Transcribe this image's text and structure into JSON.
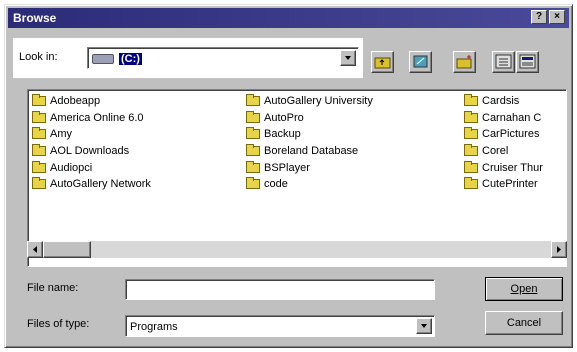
{
  "window": {
    "title": "Browse",
    "help_btn": "?",
    "close_btn": "×"
  },
  "lookin": {
    "label": "Look in:",
    "value": "(C:)"
  },
  "files": {
    "col1": [
      "Adobeapp",
      "America Online 6.0",
      "Amy",
      "AOL Downloads",
      "Audiopci",
      "AutoGallery Network"
    ],
    "col2": [
      "AutoGallery University",
      "AutoPro",
      "Backup",
      "Boreland Database",
      "BSPlayer",
      "code"
    ],
    "col3": [
      "Cardsis",
      "Carnahan C",
      "CarPictures",
      "Corel",
      "Cruiser Thur",
      "CutePrinter"
    ]
  },
  "filename": {
    "label": "File name:",
    "value": ""
  },
  "filetype": {
    "label": "Files of type:",
    "value": "Programs"
  },
  "buttons": {
    "open": "Open",
    "cancel": "Cancel"
  },
  "colors": {
    "title_bar": "#2b2b78",
    "face": "#c0c0c0",
    "folder": "#e8d44a"
  }
}
